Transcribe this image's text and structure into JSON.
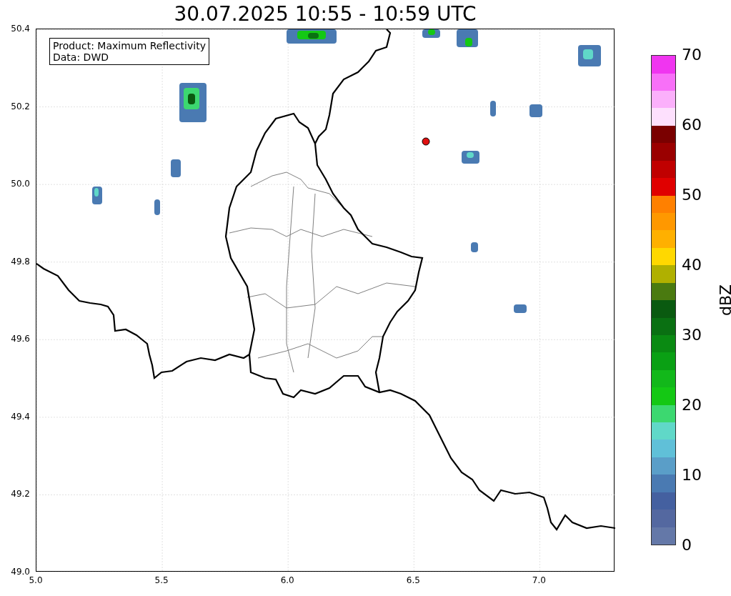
{
  "title": "30.07.2025 10:55 - 10:59 UTC",
  "info_box": {
    "lines": [
      "Product: Maximum Reflectivity",
      "Data: DWD"
    ]
  },
  "y_ticks": [
    "50.4",
    "50.2",
    "50.0",
    "49.8",
    "49.6",
    "49.4",
    "49.2",
    "49.0"
  ],
  "x_ticks": [
    "5.0",
    "5.5",
    "6.0",
    "6.5",
    "7.0"
  ],
  "colorbar": {
    "label": "dBZ",
    "ticks": [
      "70",
      "60",
      "50",
      "40",
      "30",
      "20",
      "10",
      "0"
    ],
    "bands": [
      {
        "color": "#6478a8"
      },
      {
        "color": "#5468a0"
      },
      {
        "color": "#4460a0"
      },
      {
        "color": "#4a7ab2"
      },
      {
        "color": "#5a9ec8"
      },
      {
        "color": "#60c0d8"
      },
      {
        "color": "#60d8c8"
      },
      {
        "color": "#3cd870"
      },
      {
        "color": "#14c814"
      },
      {
        "color": "#12b81a"
      },
      {
        "color": "#0aa014"
      },
      {
        "color": "#0a8a12"
      },
      {
        "color": "#0a7012"
      },
      {
        "color": "#0a5a10"
      },
      {
        "color": "#4a7a10"
      },
      {
        "color": "#b0b000"
      },
      {
        "color": "#ffd800"
      },
      {
        "color": "#ffb000"
      },
      {
        "color": "#ff9800"
      },
      {
        "color": "#ff8000"
      },
      {
        "color": "#e00000"
      },
      {
        "color": "#c00000"
      },
      {
        "color": "#9a0000"
      },
      {
        "color": "#7a0000"
      },
      {
        "color": "#fde0fd"
      },
      {
        "color": "#fbb0fb"
      },
      {
        "color": "#f870f8"
      },
      {
        "color": "#f035f0"
      }
    ]
  }
}
